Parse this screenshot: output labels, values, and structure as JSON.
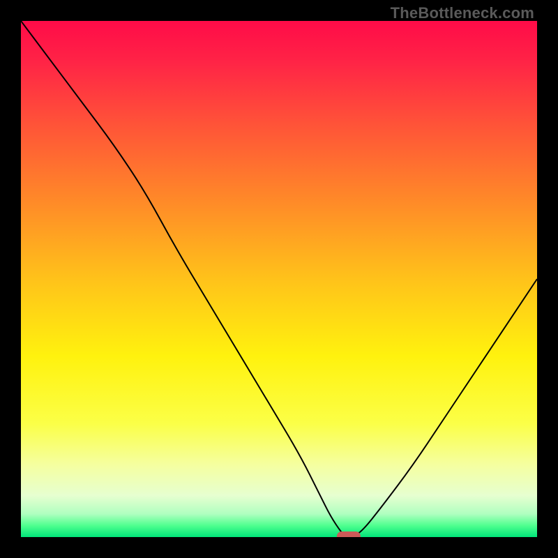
{
  "watermark": "TheBottleneck.com",
  "colors": {
    "gradient_stops": [
      {
        "offset": 0.0,
        "color": "#ff0b48"
      },
      {
        "offset": 0.08,
        "color": "#ff2446"
      },
      {
        "offset": 0.2,
        "color": "#ff5338"
      },
      {
        "offset": 0.35,
        "color": "#ff8a28"
      },
      {
        "offset": 0.5,
        "color": "#ffc21a"
      },
      {
        "offset": 0.65,
        "color": "#fff20e"
      },
      {
        "offset": 0.78,
        "color": "#fbff47"
      },
      {
        "offset": 0.86,
        "color": "#f5ffa0"
      },
      {
        "offset": 0.92,
        "color": "#e6ffd0"
      },
      {
        "offset": 0.955,
        "color": "#b0ffc0"
      },
      {
        "offset": 0.978,
        "color": "#4eff8e"
      },
      {
        "offset": 1.0,
        "color": "#00e57a"
      }
    ],
    "curve_stroke": "#000000",
    "marker_fill": "#cc5a58",
    "frame": "#000000"
  },
  "chart_data": {
    "type": "line",
    "title": "",
    "xlabel": "",
    "ylabel": "",
    "xlim": [
      0,
      100
    ],
    "ylim": [
      0,
      100
    ],
    "grid": false,
    "x": [
      0,
      6,
      12,
      18,
      24,
      30,
      36,
      42,
      48,
      54,
      58,
      60,
      62,
      63,
      64,
      66,
      70,
      76,
      82,
      88,
      94,
      100
    ],
    "values": [
      100,
      92,
      84,
      76,
      67,
      56,
      46,
      36,
      26,
      16,
      8,
      4,
      1,
      0,
      0,
      1,
      6,
      14,
      23,
      32,
      41,
      50
    ],
    "annotations": [
      {
        "type": "marker",
        "shape": "pill",
        "x": 63.5,
        "y": 0,
        "label": ""
      }
    ]
  }
}
